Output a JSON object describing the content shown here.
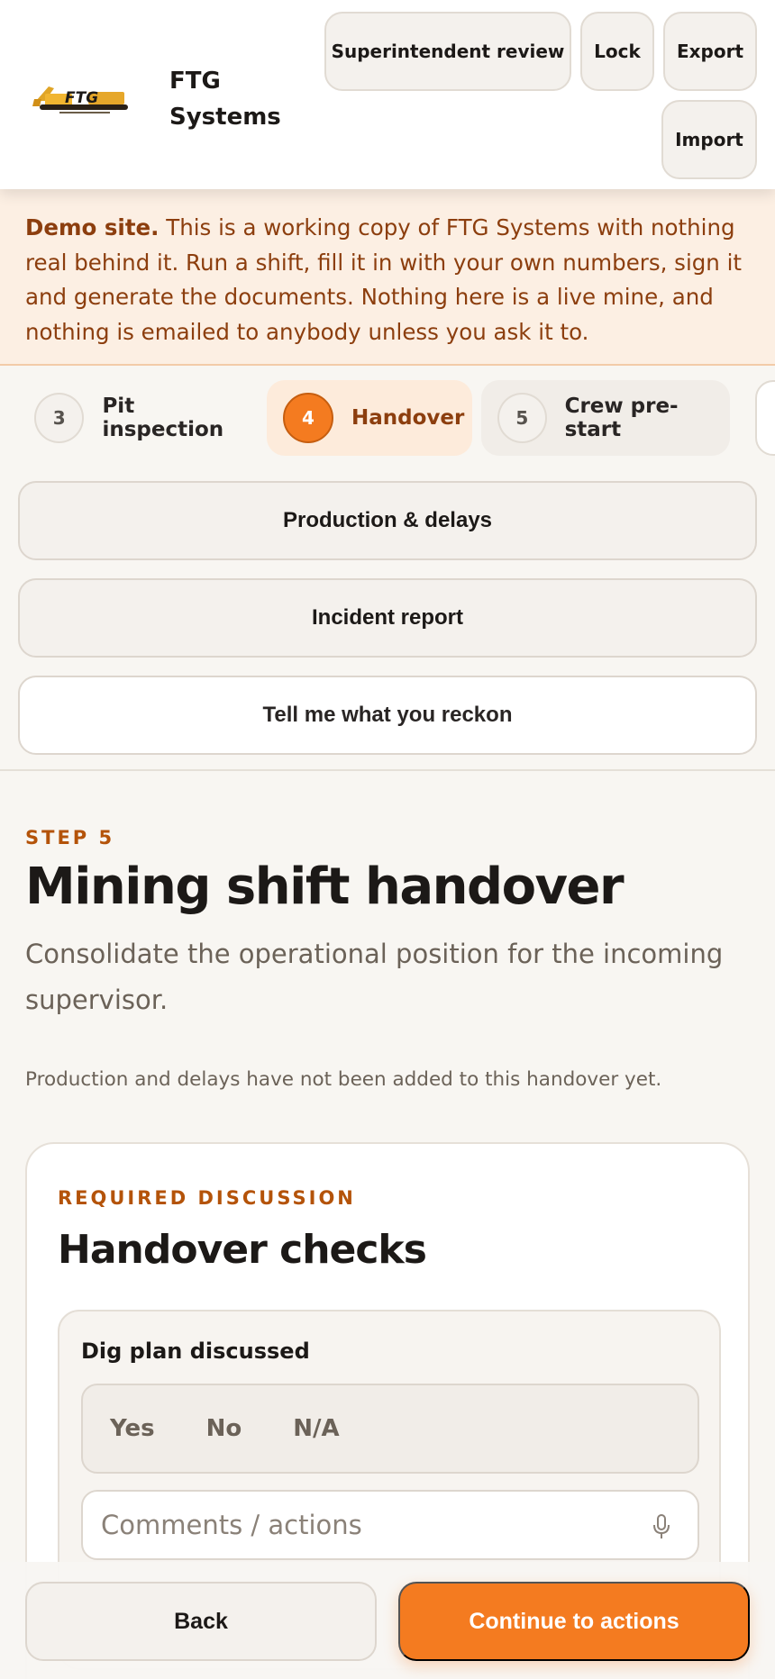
{
  "header": {
    "logo_text": "FTG",
    "brand_name": "FTG Systems",
    "buttons": {
      "superintendent_review": "Superintendent review",
      "lock": "Lock",
      "export": "Export",
      "import": "Import"
    }
  },
  "banner": {
    "lead": "Demo site.",
    "text": " This is a working copy of FTG Systems with nothing real behind it. Run a shift, fill it in with your own numbers, sign it and generate the documents. Nothing here is a live mine, and nothing is emailed to anybody unless you ask it to."
  },
  "stepper": {
    "steps": [
      {
        "number": "3",
        "label": "Pit inspection",
        "state": "default"
      },
      {
        "number": "4",
        "label": "Handover",
        "state": "active"
      },
      {
        "number": "5",
        "label": "Crew pre-start",
        "state": "default"
      }
    ]
  },
  "actions": {
    "production_delays": "Production & delays",
    "incident_report": "Incident report",
    "tell_me": "Tell me what you reckon"
  },
  "main": {
    "eyebrow": "STEP 5",
    "title": "Mining shift handover",
    "subtitle": "Consolidate the operational position for the incoming supervisor.",
    "notice": "Production and delays have not been added to this handover yet."
  },
  "card": {
    "eyebrow": "REQUIRED DISCUSSION",
    "title": "Handover checks",
    "check": {
      "label": "Dig plan discussed",
      "options": [
        "Yes",
        "No",
        "N/A"
      ],
      "comment_placeholder": "Comments / actions"
    }
  },
  "footer": {
    "back": "Back",
    "continue": "Continue to actions"
  },
  "colors": {
    "accent": "#f47b20",
    "banner_bg": "#fcefe3",
    "banner_text": "#8c3e0e",
    "eyebrow": "#b45309"
  },
  "icons": {
    "logo": "excavator-logo",
    "comment": "microphone-icon"
  }
}
